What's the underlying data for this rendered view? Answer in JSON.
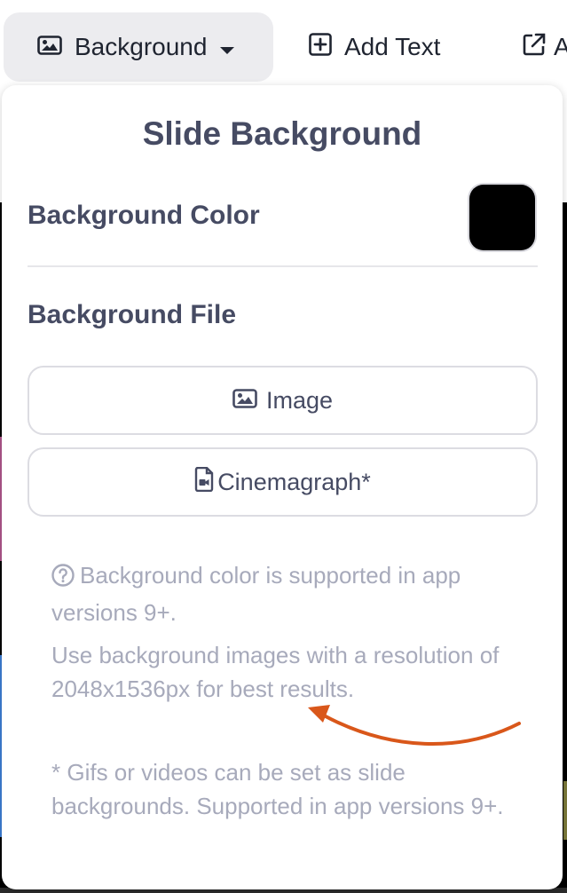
{
  "toolbar": {
    "background_label": "Background",
    "add_text_label": "Add Text",
    "external_label": "A"
  },
  "popover": {
    "title": "Slide Background",
    "background_color_label": "Background Color",
    "background_color_value": "#000000",
    "background_file_label": "Background File",
    "image_button_label": "Image",
    "cinemagraph_button_label": "Cinemagraph*",
    "note_color": "Background color is supported in app versions 9+.",
    "note_resolution": "Use background images with a resolution of 2048x1536px for best results.",
    "note_gif": "* Gifs or videos can be set as slide backgrounds. Supported in app versions 9+."
  },
  "colors": {
    "heading": "#464b63",
    "muted": "#a7aabb",
    "annotation_arrow": "#d9571a"
  },
  "icons": [
    "image-icon",
    "caret-down-icon",
    "plus-square-icon",
    "external-link-icon",
    "file-video-icon",
    "question-circle-icon"
  ]
}
